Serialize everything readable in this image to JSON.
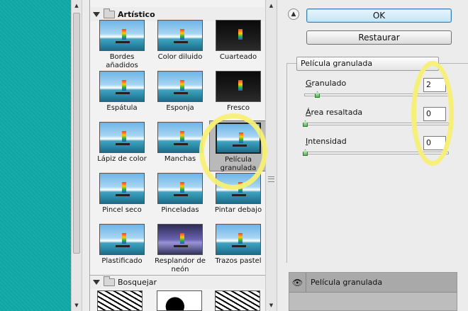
{
  "preview": {
    "name": "filter-preview"
  },
  "gallery": {
    "category_artistic": "Artístico",
    "category_sketch": "Bosquejar",
    "items": [
      {
        "label": "Bordes añadidos"
      },
      {
        "label": "Color diluido"
      },
      {
        "label": "Cuarteado"
      },
      {
        "label": "Espátula"
      },
      {
        "label": "Esponja"
      },
      {
        "label": "Fresco"
      },
      {
        "label": "Lápiz de color"
      },
      {
        "label": "Manchas"
      },
      {
        "label": "Película granulada"
      },
      {
        "label": "Pincel seco"
      },
      {
        "label": "Pinceladas"
      },
      {
        "label": "Pintar debajo"
      },
      {
        "label": "Plastificado"
      },
      {
        "label": "Resplandor de neón"
      },
      {
        "label": "Trazos pastel"
      }
    ],
    "selected_index": 8
  },
  "buttons": {
    "ok": "OK",
    "restore": "Restaurar"
  },
  "filter_select": {
    "value": "Película granulada"
  },
  "params": [
    {
      "label_pre": "",
      "label_ul": "G",
      "label_post": "ranulado",
      "value": "2",
      "level": 0.11
    },
    {
      "label_pre": "",
      "label_ul": "Á",
      "label_post": "rea resaltada",
      "value": "0",
      "level": 0
    },
    {
      "label_pre": "",
      "label_ul": "I",
      "label_post": "ntensidad",
      "value": "0",
      "level": 0
    }
  ],
  "layers": {
    "effect_name": "Película granulada"
  },
  "colors": {
    "preview_bg": "#10aaa7",
    "highlight": "#f7ef74",
    "ok_border": "#3c7fb1"
  }
}
